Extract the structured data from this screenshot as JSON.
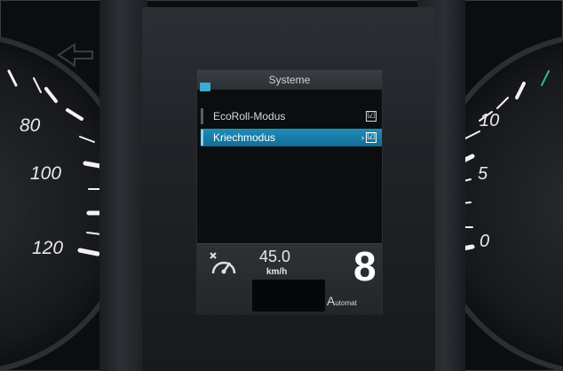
{
  "menu": {
    "title": "Systeme",
    "items": [
      {
        "label": "EcoRoll-Modus",
        "checked": true,
        "selected": false
      },
      {
        "label": "Kriechmodus",
        "checked": true,
        "selected": true
      }
    ],
    "check_glyph": "☑",
    "select_arrow": "›"
  },
  "status": {
    "speed_value": "45.0",
    "speed_unit": "km/h",
    "gear": "8",
    "mode_cap": "A",
    "mode_rest": "utomat"
  },
  "gauge_left": {
    "tick_labels": [
      "80",
      "100",
      "120"
    ]
  },
  "gauge_right": {
    "tick_labels": [
      "10",
      "5",
      "0"
    ]
  },
  "colors": {
    "accent": "#1e8cb9",
    "accent_light": "#3fa9d6",
    "gauge_tick": "#f2f2f2",
    "teal_tick": "#2fb3a6"
  },
  "icons": [
    "menu-icon",
    "speedometer-icon",
    "checkbox-icon",
    "left-arrow-icon",
    "right-arrow-icon"
  ]
}
